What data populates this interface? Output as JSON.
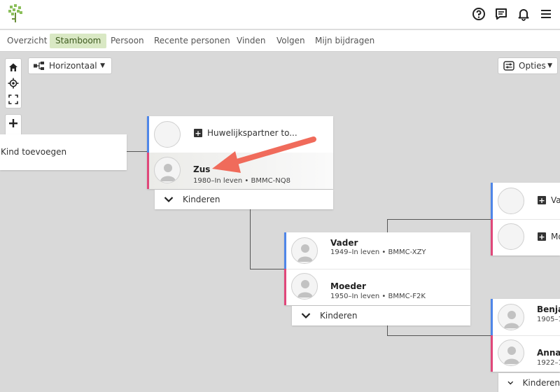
{
  "header": {
    "logo": "familysearch-tree-logo",
    "icons": [
      "help-icon",
      "messages-icon",
      "notifications-icon",
      "menu-icon"
    ]
  },
  "nav": {
    "tabs": [
      "Overzicht",
      "Stamboom",
      "Persoon",
      "Recente personen",
      "Vinden",
      "Volgen",
      "Mijn bijdragen"
    ],
    "active": "Stamboom"
  },
  "controls": {
    "view_label": "Horizontaal",
    "options_label": "Opties"
  },
  "tree": {
    "add_child_label": "Kind toevoegen",
    "children_label": "Kinderen",
    "add_spouse_label": "Huwelijkspartner to...",
    "focus": {
      "name": "Zus",
      "info": "1980–In leven • BMMC-NQ8"
    },
    "father": {
      "name": "Vader",
      "info": "1949–In leven • BMMC-XZY"
    },
    "mother": {
      "name": "Moeder",
      "info": "1950–In leven • BMMC-F2K"
    },
    "add_father_partial": "Va",
    "add_mother_partial": "Mo",
    "grandfather": {
      "name": "Benja",
      "info": "1905–1"
    },
    "grandmother": {
      "name": "Anna",
      "info": "1922–1"
    }
  },
  "colors": {
    "male": "#4f86e8",
    "female": "#e0477a",
    "active_tab_bg": "#d9e8c4",
    "arrow": "#f06b5b"
  }
}
